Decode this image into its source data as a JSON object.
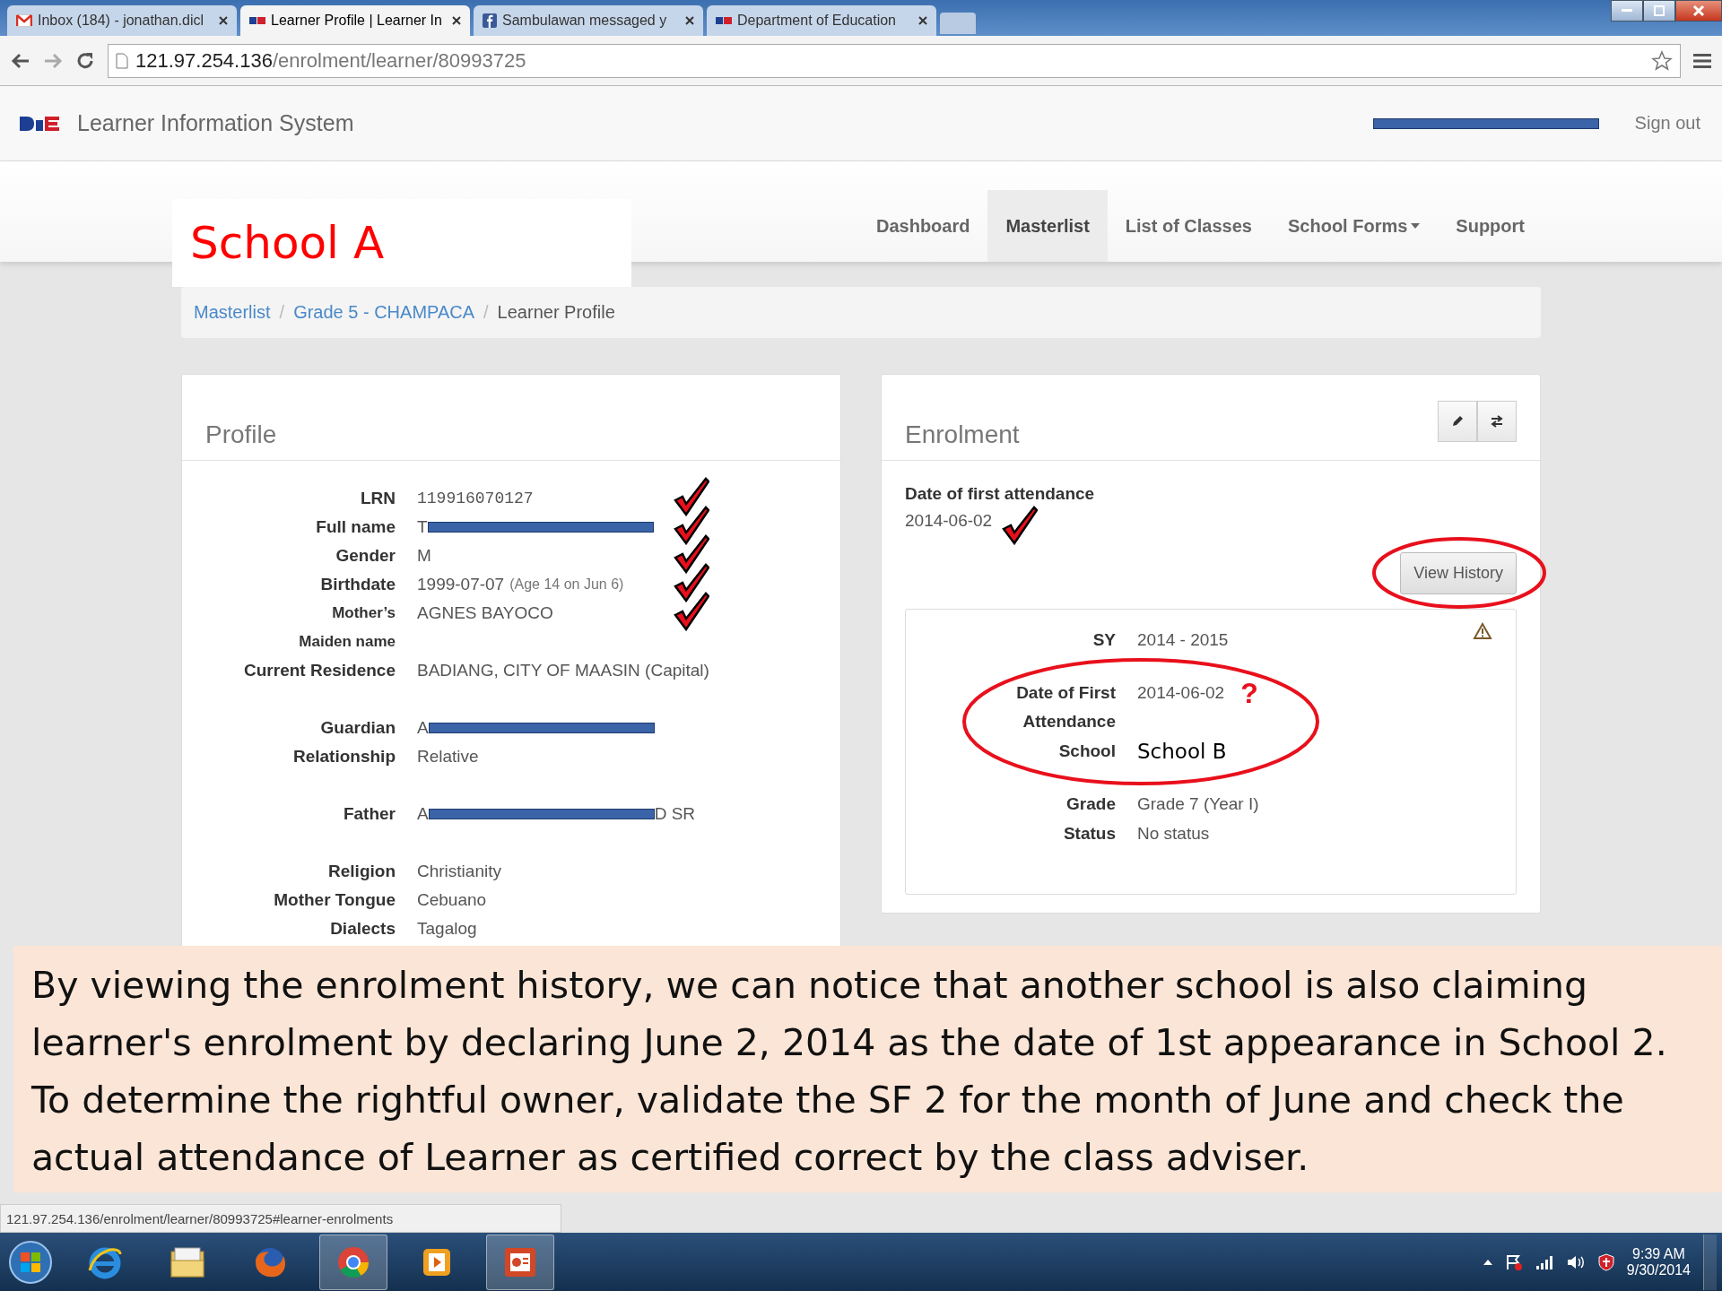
{
  "browser": {
    "tabs": [
      {
        "title": "Inbox (184) - jonathan.dicl",
        "kind": "mail",
        "selected": false
      },
      {
        "title": "Learner Profile | Learner In",
        "kind": "logo",
        "selected": true
      },
      {
        "title": "Sambulawan messaged y",
        "kind": "social",
        "selected": false
      },
      {
        "title": "Department of Education",
        "kind": "logo",
        "selected": false
      }
    ],
    "address": {
      "host": "121.97.254.136",
      "path": "/enrolment/learner/80993725"
    }
  },
  "app": {
    "brand": "Learner Information System",
    "user_redacted": true,
    "sign_out": "Sign out",
    "nav": [
      {
        "label": "Dashboard",
        "selected": false,
        "dropdown": false
      },
      {
        "label": "Masterlist",
        "selected": true,
        "dropdown": false
      },
      {
        "label": "List of Classes",
        "selected": false,
        "dropdown": false
      },
      {
        "label": "School Forms",
        "selected": false,
        "dropdown": true
      },
      {
        "label": "Support",
        "selected": false,
        "dropdown": false
      }
    ]
  },
  "breadcrumb": [
    {
      "label": "Masterlist",
      "link": true
    },
    {
      "separator": "/",
      "label": "Grade 5 - CHAMPACA",
      "link": true
    },
    {
      "separator": "/",
      "label": "Learner Profile",
      "link": false
    }
  ],
  "profile": {
    "title": "Profile",
    "groups": [
      [
        {
          "label": "LRN",
          "value": "119916070127",
          "kind": "mono",
          "ticked": true
        },
        {
          "label": "Full name",
          "value": "T",
          "redacted": true,
          "kind": "text",
          "ticked": true
        },
        {
          "label": "Gender",
          "value": "M",
          "kind": "text",
          "ticked": true
        },
        {
          "label": "Birthdate",
          "value": "1999-07-07",
          "note": "(Age 14 on Jun 6)",
          "kind": "text",
          "ticked": true
        },
        {
          "label": "Mother’s",
          "value": "AGNES BAYOCO",
          "kind": "small",
          "ticked": true
        },
        {
          "label": "Maiden name",
          "kind": "small",
          "ticked": false
        },
        {
          "label": "Current Residence",
          "value": "BADIANG, CITY OF MAASIN (Capital)",
          "kind": "text",
          "ticked": false
        }
      ],
      [
        {
          "label": "Guardian",
          "value": "A",
          "redacted": true,
          "kind": "text",
          "ticked": false
        },
        {
          "label": "Relationship",
          "value": "Relative",
          "kind": "text",
          "ticked": false
        }
      ],
      [
        {
          "label": "Father",
          "value": "A",
          "redacted": true,
          "value_end": "D SR",
          "kind": "text",
          "ticked": false
        }
      ],
      [
        {
          "label": "Religion",
          "value": "Christianity",
          "kind": "text",
          "ticked": false
        },
        {
          "label": "Mother Tongue",
          "value": "Cebuano",
          "kind": "text",
          "ticked": false
        },
        {
          "label": "Dialects",
          "value": "Tagalog",
          "kind": "text",
          "ticked": false
        }
      ]
    ]
  },
  "enrolment": {
    "title": "Enrolment",
    "first_attendance": {
      "label": "Date of first attendance",
      "value": "2014-06-02",
      "ticked": true
    },
    "view_history": "View History",
    "history": [
      {
        "label": "SY",
        "value": "2014 - 2015",
        "kind": "text",
        "circled": false
      },
      {
        "label": "Date of First Attendance",
        "value": "2014-06-02",
        "kind": "text",
        "question": "?",
        "circled": true
      },
      {
        "label": "School",
        "value": "School B",
        "kind": "annotation",
        "circled": true
      },
      {
        "label": "Grade",
        "value": "Grade 7 (Year I)",
        "kind": "text",
        "circled": false
      },
      {
        "label": "Status",
        "value": "No status",
        "kind": "text",
        "circled": false
      }
    ]
  },
  "annotations": {
    "school_label": "School A",
    "note": "By viewing the enrolment history, we can notice that another school is also claiming learner's enrolment by declaring June 2, 2014 as the date of 1st appearance in School 2.  To determine the rightful owner, validate the SF 2 for the month of June and check the actual attendance of Learner as certified correct by the class adviser."
  },
  "status_url": "121.97.254.136/enrolment/learner/80993725#learner-enrolments",
  "taskbar": {
    "apps": [
      {
        "kind": "browser-e",
        "selected": false
      },
      {
        "kind": "folder",
        "selected": false
      },
      {
        "kind": "fox",
        "selected": false
      },
      {
        "kind": "chrome",
        "selected": true
      },
      {
        "kind": "media",
        "selected": false
      },
      {
        "kind": "slides",
        "selected": true
      }
    ],
    "time": "9:39 AM",
    "date": "9/30/2014"
  }
}
